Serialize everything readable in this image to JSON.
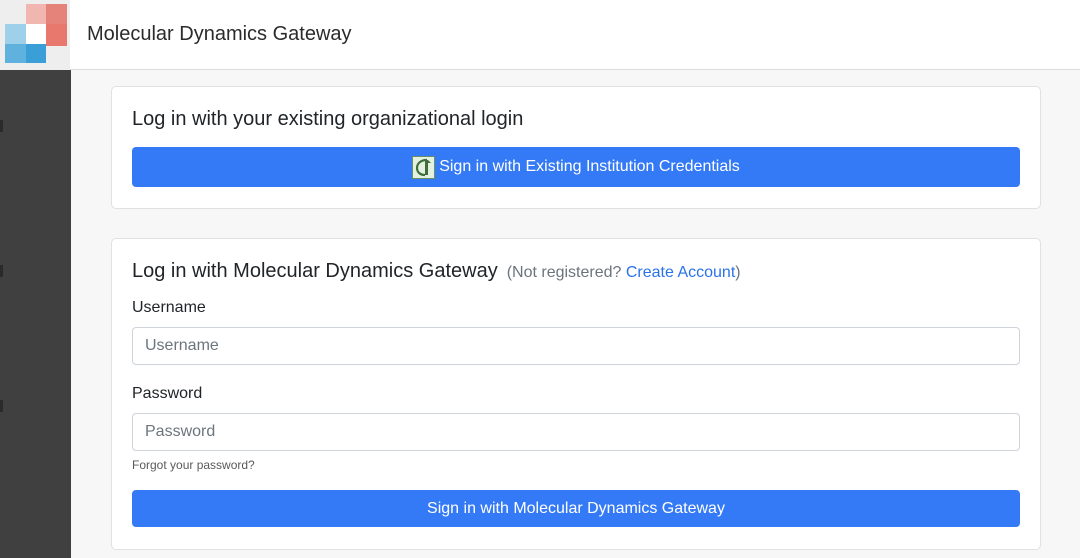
{
  "header": {
    "app_title": "Molecular Dynamics Gateway"
  },
  "org_login": {
    "heading": "Log in with your existing organizational login",
    "button_label": "Sign in with Existing Institution Credentials",
    "button_icon": "institution-logo-icon"
  },
  "gateway_login": {
    "heading": "Log in with Molecular Dynamics Gateway",
    "not_registered_prefix": "(Not registered? ",
    "create_account_label": "Create Account",
    "not_registered_suffix": ")",
    "username_label": "Username",
    "username_placeholder": "Username",
    "username_value": "",
    "password_label": "Password",
    "password_placeholder": "Password",
    "password_value": "",
    "forgot_label": "Forgot your password?",
    "submit_label": "Sign in with Molecular Dynamics Gateway"
  },
  "colors": {
    "primary": "#3479f6",
    "link": "#2a72e8",
    "sidebar": "#404040"
  }
}
